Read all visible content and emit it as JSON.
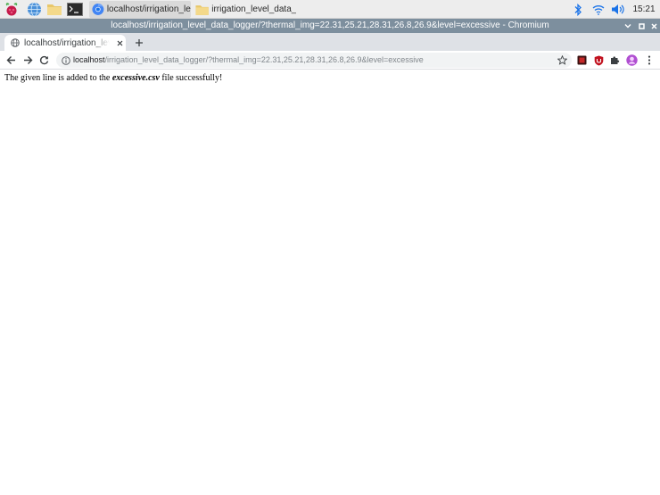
{
  "taskbar": {
    "tasks": [
      {
        "label": "localhost/irrigation_le...",
        "icon": "chromium-icon"
      },
      {
        "label": "irrigation_level_data_l...",
        "icon": "folder-icon"
      }
    ],
    "clock": "15:21"
  },
  "window": {
    "title": "localhost/irrigation_level_data_logger/?thermal_img=22.31,25.21,28.31,26.8,26.9&level=excessive - Chromium"
  },
  "browser": {
    "tab": {
      "title": "localhost/irrigation_level_data_logger/"
    },
    "url": {
      "host": "localhost",
      "path": "/irrigation_level_data_logger/?thermal_img=22.31,25.21,28.31,26.8,26.9&level=excessive"
    }
  },
  "page": {
    "message_before": "The given line is added to the ",
    "filename": "excessive.csv",
    "message_after": " file successfully!"
  },
  "colors": {
    "titlebar": "#7d8f9e",
    "tabstrip": "#dee1e6",
    "omnibox": "#f1f3f4",
    "accent": "#1a73e8"
  }
}
